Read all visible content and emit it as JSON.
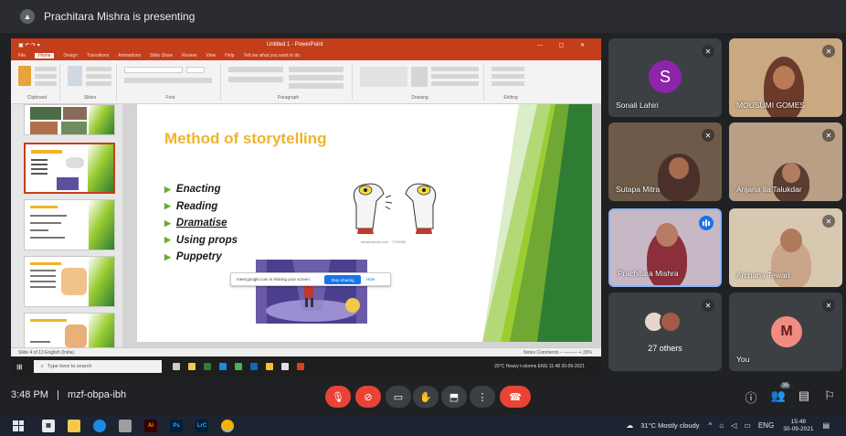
{
  "presenting": {
    "text": "Prachitara Mishra is presenting",
    "icon": "present-to-all-icon"
  },
  "powerpoint": {
    "window_title": "Untitled 1 - PowerPoint",
    "tabs": [
      "File",
      "Home",
      "Design",
      "Transitions",
      "Animations",
      "Slide Show",
      "Review",
      "View",
      "Help",
      "Tell me what you want to do"
    ],
    "active_tab": "Home",
    "ribbon_groups": [
      "Clipboard",
      "Slides",
      "Font",
      "Paragraph",
      "Drawing",
      "Editing"
    ],
    "slide": {
      "title": "Method of storytelling",
      "bullets": [
        "Enacting",
        "Reading",
        "Dramatise",
        "Using props",
        "Puppetry"
      ],
      "image_credit": "shutterstock.com · 7192005"
    },
    "status": {
      "left": "Slide 4 of 13   English (India)",
      "right": "Notes   Comments   −  ———  +  33%"
    },
    "share_notice": {
      "text": "meet.google.com is sharing your screen.",
      "stop_label": "Stop sharing",
      "hide_label": "Hide"
    },
    "inner_taskbar": {
      "search_placeholder": "Type here to search",
      "tray": "20°C Heavy t-storms  ENG  11:48  30-09-2021"
    }
  },
  "participants": [
    {
      "name": "Sonali Lahiri",
      "initial": "S",
      "muted": true
    },
    {
      "name": "MOUSUMI GOMES",
      "muted": true
    },
    {
      "name": "Sutapa Mitra",
      "muted": true
    },
    {
      "name": "Anjana ila Talukdar",
      "muted": true
    },
    {
      "name": "Prachitara Mishra",
      "speaking": true
    },
    {
      "name": "Archana Tewari",
      "muted": true
    },
    {
      "name": "27 others",
      "muted": true
    },
    {
      "name": "You",
      "initial": "M",
      "muted": true
    }
  ],
  "meet": {
    "time": "3:48 PM",
    "separator": "|",
    "code": "mzf-obpa-ibh",
    "participant_badge": "35",
    "controls": [
      "mic-off-icon",
      "camera-off-icon",
      "captions-icon",
      "raise-hand-icon",
      "present-icon",
      "more-options-icon",
      "end-call-icon"
    ]
  },
  "taskbar": {
    "weather": "31°C  Mostly cloudy",
    "lang": "ENG",
    "time": "15:48",
    "date": "30-09-2021",
    "apps": [
      "Ai",
      "Ps",
      "LrC"
    ]
  },
  "colors": {
    "accent": "#1a73e8",
    "danger": "#ea4335",
    "ppt": "#c43e1c",
    "slide_title": "#f0b429",
    "avatar_s": "#8e24aa"
  }
}
